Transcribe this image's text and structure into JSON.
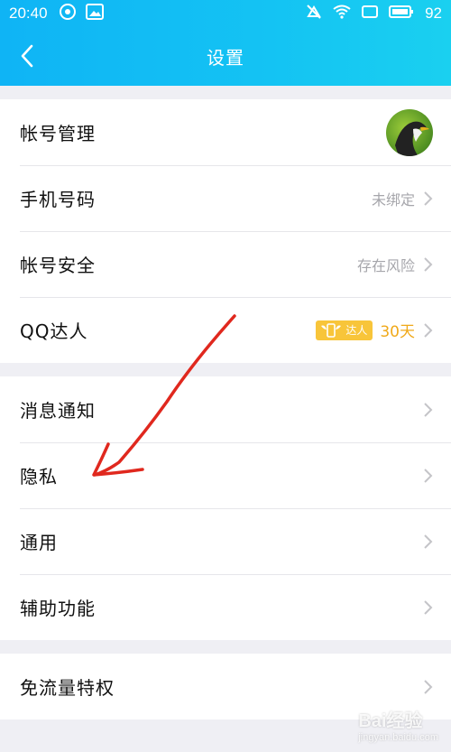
{
  "status_bar": {
    "time": "20:40",
    "battery_level": "92"
  },
  "nav": {
    "title": "设置"
  },
  "groups": [
    {
      "items": [
        {
          "label": "帐号管理",
          "value": ""
        },
        {
          "label": "手机号码",
          "value": "未绑定"
        },
        {
          "label": "帐号安全",
          "value": "存在风险"
        },
        {
          "label": "QQ达人",
          "badge_text": "达人",
          "days": "30天"
        }
      ]
    },
    {
      "items": [
        {
          "label": "消息通知"
        },
        {
          "label": "隐私"
        },
        {
          "label": "通用"
        },
        {
          "label": "辅助功能"
        }
      ]
    },
    {
      "items": [
        {
          "label": "免流量特权"
        }
      ]
    }
  ],
  "watermark": {
    "brand": "Bai经验",
    "url": "jingyan.baidu.com"
  },
  "colors": {
    "header_start": "#0fb4f5",
    "header_end": "#1ad0f0",
    "annotation_red": "#e0281e",
    "badge_gold": "#f8c53a"
  }
}
